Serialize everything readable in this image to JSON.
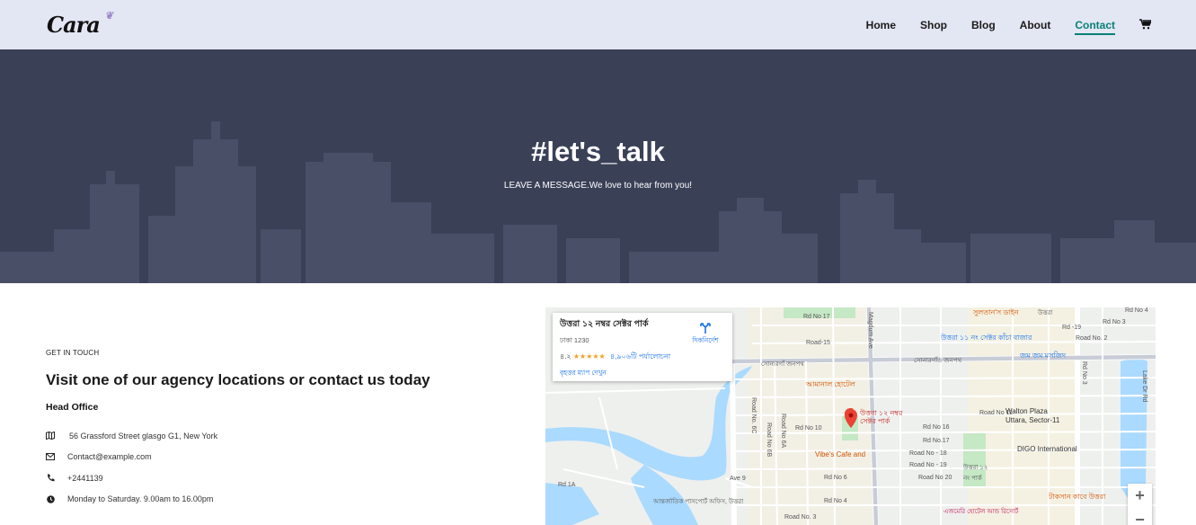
{
  "nav": {
    "logo": "Cara",
    "items": [
      {
        "label": "Home"
      },
      {
        "label": "Shop"
      },
      {
        "label": "Blog"
      },
      {
        "label": "About"
      },
      {
        "label": "Contact",
        "active": true
      }
    ],
    "cart_icon": "cart-icon",
    "accent": "#088178"
  },
  "hero": {
    "title": "#let's_talk",
    "subtitle": "LEAVE A MESSAGE.We love to hear from you!",
    "bg_color": "#3a4157"
  },
  "contact": {
    "kicker": "GET IN TOUCH",
    "heading": "Visit one of our agency locations or contact us today",
    "office_title": "Head Office",
    "items": [
      {
        "icon": "map-icon",
        "text": "56 Grassford Street glasgo G1, New York"
      },
      {
        "icon": "envelope-icon",
        "text": "Contact@example.com"
      },
      {
        "icon": "phone-icon",
        "text": "+2441139"
      },
      {
        "icon": "clock-icon",
        "text": "Monday to Saturday. 9.00am to 16.00pm"
      }
    ]
  },
  "map": {
    "card": {
      "title": "উত্তরা ১২ নম্বর সেক্টর পার্ক",
      "subtitle": "ঢাকা 1230",
      "rating": "৪.২",
      "stars": "★★★★★",
      "reviews": "৪,৯০৬টি পর্যালোচনা",
      "link": "বৃহত্তর ম্যাপ দেখুন",
      "directions": "দিকনির্দেশ"
    },
    "labels": {
      "rd_no_17": "Rd No 17",
      "road_15": "Road-15",
      "road_no_6c": "Road No. 6C",
      "road_no_6a": "Road No 6A",
      "road_no_6b": "Road No 6B",
      "rd_no_10": "Rd No 10",
      "ave_9": "Ave 9",
      "rd_1a": "Rd 1A",
      "rd_no_6": "Rd No 6",
      "rd_no_4": "Rd No 4",
      "road_no_3": "Road No. 3",
      "rd_no_11": "Road No 11",
      "rd_no_16": "Rd No 16",
      "rd_no_17b": "Rd No.17",
      "road_no_18": "Road No - 18",
      "road_no_19": "Road No - 19",
      "road_no_20": "Road No 20",
      "rd_no_3": "Rd No 3",
      "rd_19": "Rd -19",
      "road_no_2": "Road No. 2",
      "rd_no_4b": "Rd No 4",
      "rd_no_3v": "Rd No 3",
      "magdum_ave": "Magdum Ave",
      "lake_dr": "Lake Dr Rd",
      "walton": "Walton Plaza",
      "uttara_sector": "Uttara, Sector-11",
      "digo": "DIGO International",
      "vibes": "Vibe's Cafe and",
      "park_pin": "উত্তরা ১২ নম্বর সেক্টর পার্ক",
      "sultan": "সুলতান'স ডাইন",
      "aamir_hotel": "আমানাল হোটেল",
      "uttara_sector11": "উত্তরা ১১ নং সেক্টর কাঁচা বাজার",
      "sonargaon": "সোনারগাঁ জনপথ",
      "sonargaon2": "সোনারগাঁও জনপথ",
      "postoffice": "আন্তর্জাতিক পাসপোর্ট অফিস, উত্তরা",
      "uttara": "উত্তরা",
      "jam_masjid": "জম জম মসজিদ",
      "uttara_12": "উত্তরা ১২ নং পার্ক",
      "chaat": "টাকসান কাবে উত্তরা",
      "ajmeri": "এজমেরি হোটেল আন্ড রিসোর্ট"
    }
  }
}
